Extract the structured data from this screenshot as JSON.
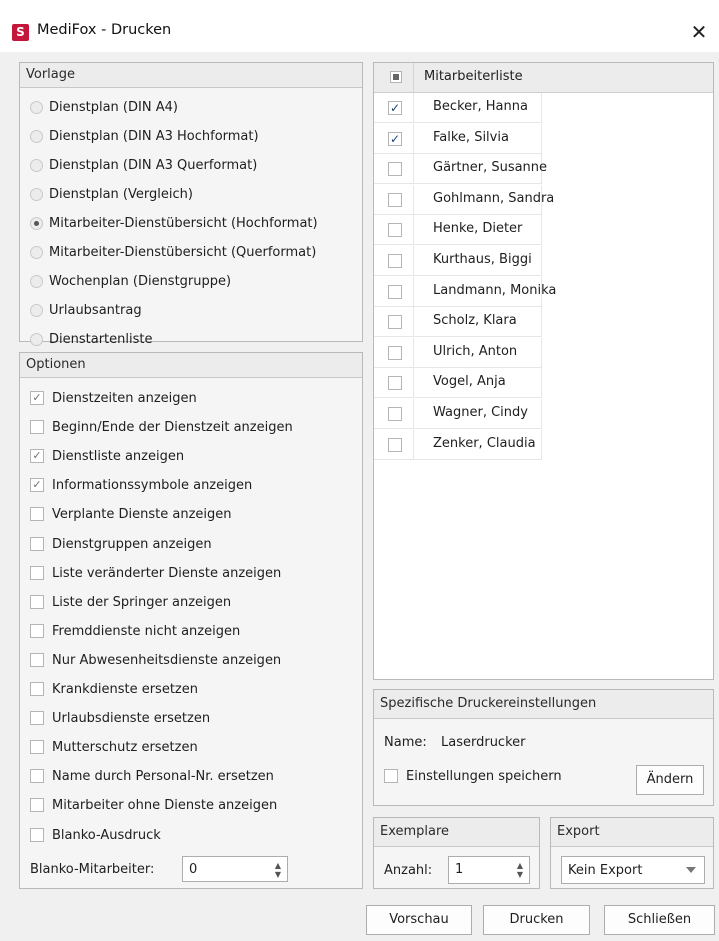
{
  "window": {
    "app_icon": "S",
    "title": "MediFox - Drucken",
    "close": "✕"
  },
  "vorlage": {
    "header": "Vorlage",
    "options": [
      {
        "label": "Dienstplan (DIN A4)",
        "selected": false
      },
      {
        "label": "Dienstplan (DIN A3 Hochformat)",
        "selected": false
      },
      {
        "label": "Dienstplan (DIN A3 Querformat)",
        "selected": false
      },
      {
        "label": "Dienstplan (Vergleich)",
        "selected": false
      },
      {
        "label": "Mitarbeiter-Dienstübersicht (Hochformat)",
        "selected": true
      },
      {
        "label": "Mitarbeiter-Dienstübersicht (Querformat)",
        "selected": false
      },
      {
        "label": "Wochenplan (Dienstgruppe)",
        "selected": false
      },
      {
        "label": "Urlaubsantrag",
        "selected": false
      },
      {
        "label": "Dienstartenliste",
        "selected": false
      }
    ]
  },
  "optionen": {
    "header": "Optionen",
    "items": [
      {
        "label": "Dienstzeiten anzeigen",
        "checked": true
      },
      {
        "label": "Beginn/Ende der Dienstzeit anzeigen",
        "checked": false
      },
      {
        "label": "Dienstliste anzeigen",
        "checked": true
      },
      {
        "label": "Informationssymbole anzeigen",
        "checked": true
      },
      {
        "label": "Verplante Dienste anzeigen",
        "checked": false
      },
      {
        "label": "Dienstgruppen anzeigen",
        "checked": false
      },
      {
        "label": "Liste veränderter Dienste anzeigen",
        "checked": false
      },
      {
        "label": "Liste der Springer anzeigen",
        "checked": false
      },
      {
        "label": "Fremddienste nicht anzeigen",
        "checked": false
      },
      {
        "label": "Nur Abwesenheitsdienste anzeigen",
        "checked": false
      },
      {
        "label": "Krankdienste ersetzen",
        "checked": false
      },
      {
        "label": "Urlaubsdienste ersetzen",
        "checked": false
      },
      {
        "label": "Mutterschutz ersetzen",
        "checked": false
      },
      {
        "label": "Name durch Personal-Nr. ersetzen",
        "checked": false
      },
      {
        "label": "Mitarbeiter ohne Dienste anzeigen",
        "checked": false
      },
      {
        "label": "Blanko-Ausdruck",
        "checked": false
      }
    ],
    "blanko_label": "Blanko-Mitarbeiter:",
    "blanko_value": "0"
  },
  "mitarbeiterliste": {
    "header": "Mitarbeiterliste",
    "rows": [
      {
        "name": "Becker, Hanna",
        "checked": true
      },
      {
        "name": "Falke, Silvia",
        "checked": true
      },
      {
        "name": "Gärtner, Susanne",
        "checked": false
      },
      {
        "name": "Gohlmann, Sandra",
        "checked": false
      },
      {
        "name": "Henke, Dieter",
        "checked": false
      },
      {
        "name": "Kurthaus, Biggi",
        "checked": false
      },
      {
        "name": "Landmann, Monika",
        "checked": false
      },
      {
        "name": "Scholz, Klara",
        "checked": false
      },
      {
        "name": "Ulrich, Anton",
        "checked": false
      },
      {
        "name": "Vogel, Anja",
        "checked": false
      },
      {
        "name": "Wagner, Cindy",
        "checked": false
      },
      {
        "name": "Zenker, Claudia",
        "checked": false
      }
    ]
  },
  "drucker": {
    "header": "Spezifische Druckereinstellungen",
    "name_label": "Name:",
    "name_value": "Laserdrucker",
    "save_label": "Einstellungen speichern",
    "change_button": "Ändern"
  },
  "exemplare": {
    "header": "Exemplare",
    "anzahl_label": "Anzahl:",
    "anzahl_value": "1"
  },
  "export": {
    "header": "Export",
    "value": "Kein Export"
  },
  "footer": {
    "preview": "Vorschau",
    "print": "Drucken",
    "close": "Schließen"
  },
  "colors": {
    "app_icon": "#c4163a",
    "check_blue": "#1f3f74"
  }
}
